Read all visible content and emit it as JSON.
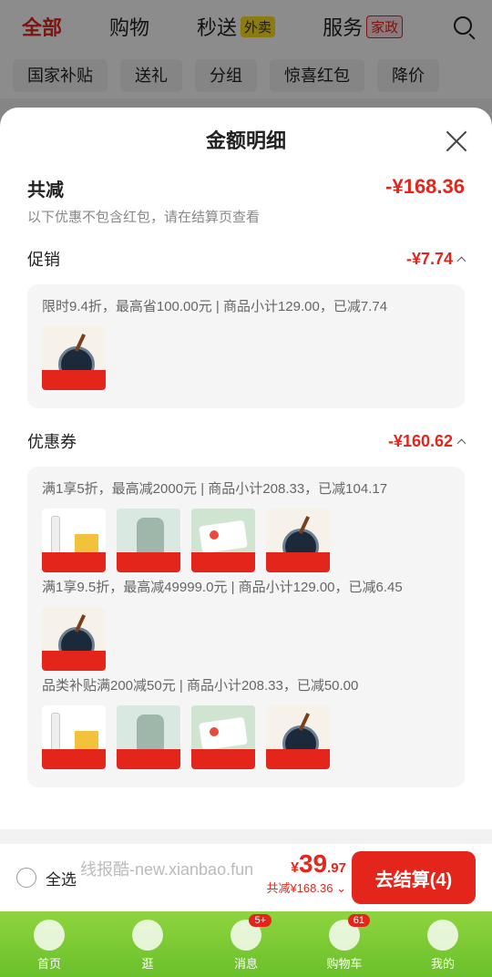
{
  "top_tabs": [
    {
      "label": "全部",
      "active": true
    },
    {
      "label": "购物",
      "active": false
    },
    {
      "label": "秒送",
      "tag": "外卖",
      "active": false
    },
    {
      "label": "服务",
      "tag": "家政",
      "active": false
    }
  ],
  "chips": [
    "国家补贴",
    "送礼",
    "分组",
    "惊喜红包",
    "降价"
  ],
  "sheet": {
    "title": "金额明细",
    "total_label": "共减",
    "total_amount": "-¥168.36",
    "note": "以下优惠不包含红包，请在结算页查看",
    "promo": {
      "label": "促销",
      "amount": "-¥7.74",
      "rule": "限时9.4折，最高省100.00元 | 商品小计129.00，已减7.74"
    },
    "coupon": {
      "label": "优惠券",
      "amount": "-¥160.62",
      "rules": [
        "满1享5折，最高减2000元 | 商品小计208.33，已减104.17",
        "满1享9.5折，最高减49999.0元 | 商品小计129.00，已减6.45",
        "品类补贴满200减50元 | 商品小计208.33，已减50.00"
      ]
    }
  },
  "checkout": {
    "select_all": "全选",
    "watermark": "线报酷-new.xianbao.fun",
    "currency": "¥",
    "price_int": "39",
    "price_dec": ".97",
    "reduce": "共减¥168.36",
    "pay_label": "去结算(4)"
  },
  "nav": [
    {
      "label": "首页"
    },
    {
      "label": "逛"
    },
    {
      "label": "消息",
      "badge": "5+"
    },
    {
      "label": "购物车",
      "badge": "61"
    },
    {
      "label": "我的"
    }
  ]
}
